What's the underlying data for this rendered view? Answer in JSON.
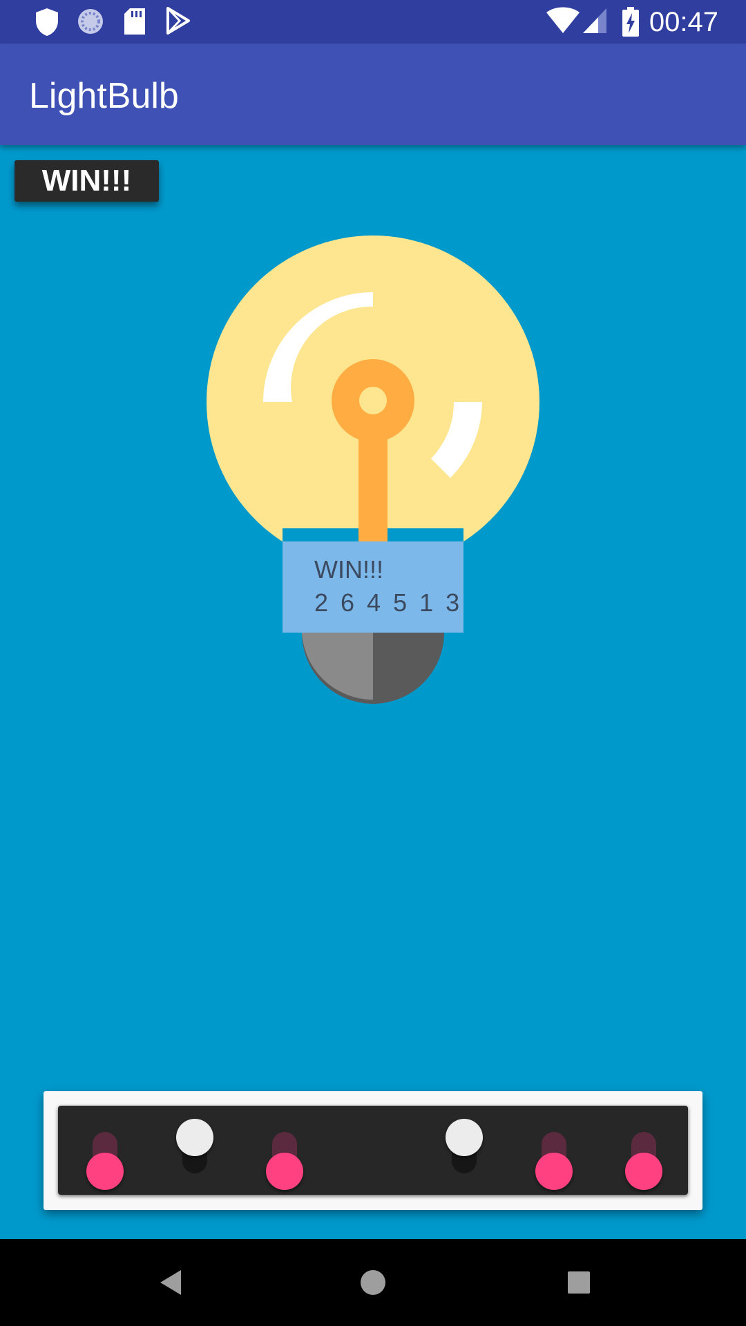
{
  "status_bar": {
    "time": "00:47",
    "left_icons": [
      "shield-icon",
      "sync-icon",
      "sd-card-icon",
      "play-store-icon"
    ],
    "right_icons": [
      "wifi-icon",
      "signal-icon",
      "battery-charging-icon"
    ]
  },
  "app_bar": {
    "title": "LightBulb"
  },
  "win_badge": {
    "label": "WIN!!!"
  },
  "bulb": {
    "label_title": "WIN!!!",
    "label_code": "2 6 4 5 1 3",
    "colors": {
      "glass": "#fde68f",
      "filament": "#ffad42",
      "base_left": "#8a8a8a",
      "base_right": "#5a5a5a",
      "label": "#7cb8ea"
    }
  },
  "switches": [
    {
      "name": "switch-1",
      "on": true
    },
    {
      "name": "switch-2",
      "on": false
    },
    {
      "name": "switch-3",
      "on": true
    },
    {
      "name": "switch-4",
      "on": false
    },
    {
      "name": "switch-5",
      "on": true
    },
    {
      "name": "switch-6",
      "on": true
    }
  ],
  "nav_bar": {
    "icons": [
      "back-icon",
      "home-icon",
      "recents-icon"
    ]
  },
  "colors": {
    "background": "#0099cc",
    "app_bar": "#3f51b5",
    "status_bar": "#303f9f",
    "accent": "#ff4081"
  }
}
